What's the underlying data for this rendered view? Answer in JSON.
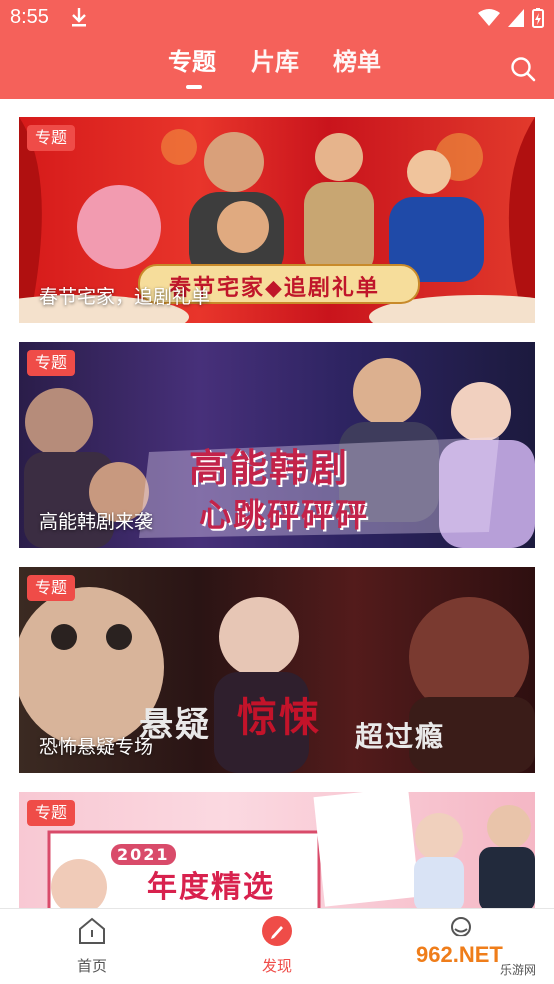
{
  "status": {
    "time": "8:55"
  },
  "header": {
    "tabs": [
      {
        "label": "专题",
        "active": true
      },
      {
        "label": "片库",
        "active": false
      },
      {
        "label": "榜单",
        "active": false
      }
    ],
    "accent": "#f5615a"
  },
  "cards": [
    {
      "badge": "专题",
      "title": "春节宅家，追剧礼单",
      "banner": "春节宅家◆追剧礼单"
    },
    {
      "badge": "专题",
      "title": "高能韩剧来袭",
      "banner_line1": "高能韩剧",
      "banner_line2": "心跳砰砰砰"
    },
    {
      "badge": "专题",
      "title": "恐怖悬疑专场",
      "banner_left": "悬疑",
      "banner_mid": "惊悚",
      "banner_right": "超过瘾"
    },
    {
      "badge": "专题",
      "year": "2021",
      "banner": "年度精选"
    }
  ],
  "bottom_nav": [
    {
      "label": "首页",
      "icon": "home-icon"
    },
    {
      "label": "发现",
      "icon": "discover-icon",
      "active": true
    },
    {
      "label": "",
      "icon": "profile-icon"
    }
  ],
  "watermark": {
    "text": "962.NET",
    "sub": "乐游网"
  }
}
